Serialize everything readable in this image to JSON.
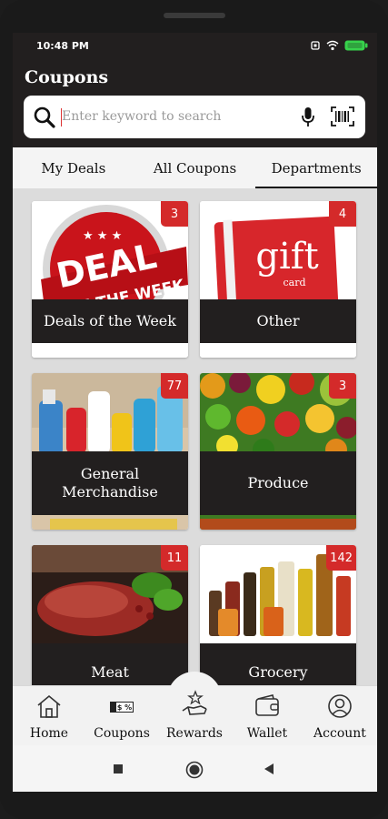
{
  "status": {
    "time": "10:48 PM"
  },
  "header": {
    "title": "Coupons"
  },
  "search": {
    "placeholder": "Enter keyword to search"
  },
  "tabs": [
    {
      "label": "My Deals"
    },
    {
      "label": "All Coupons"
    },
    {
      "label": "Departments",
      "active": true
    }
  ],
  "categories": [
    {
      "name": "Deals of the Week",
      "count": "3",
      "image_text": [
        "DEAL",
        "OF THE WEEK"
      ]
    },
    {
      "name": "Other",
      "count": "4",
      "image_text": [
        "gift",
        "card"
      ]
    },
    {
      "name": "General Merchandise",
      "count": "77"
    },
    {
      "name": "Produce",
      "count": "3"
    },
    {
      "name": "Meat",
      "count": "11"
    },
    {
      "name": "Grocery",
      "count": "142"
    }
  ],
  "nav": [
    {
      "label": "Home",
      "icon": "home-icon"
    },
    {
      "label": "Coupons",
      "icon": "coupon-icon",
      "icon_text": "$ %"
    },
    {
      "label": "Rewards",
      "icon": "rewards-icon"
    },
    {
      "label": "Wallet",
      "icon": "wallet-icon"
    },
    {
      "label": "Account",
      "icon": "account-icon"
    }
  ],
  "colors": {
    "appbar": "#221f1f",
    "badge": "#d42a2a",
    "battery": "#37d14b"
  }
}
